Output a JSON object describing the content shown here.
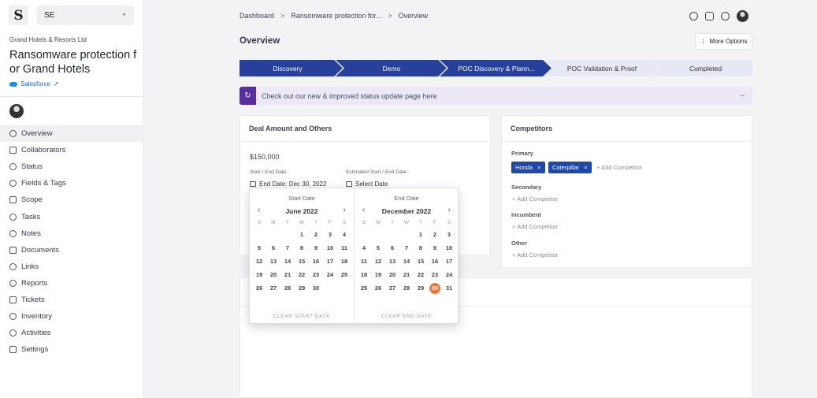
{
  "sidebar": {
    "logo_letter": "S",
    "workspace": "SE",
    "company": "Grand Hotels & Resorts Ltd",
    "title": "Ransomware protection f or Grand Hotels",
    "crm_link": "Salesforce",
    "nav": [
      {
        "label": "Overview",
        "icon": "overview-icon"
      },
      {
        "label": "Collaborators",
        "icon": "collaborators-icon"
      },
      {
        "label": "Status",
        "icon": "status-icon"
      },
      {
        "label": "Fields & Tags",
        "icon": "tag-icon"
      },
      {
        "label": "Scope",
        "icon": "scope-icon"
      },
      {
        "label": "Tasks",
        "icon": "tasks-icon"
      },
      {
        "label": "Notes",
        "icon": "notes-icon"
      },
      {
        "label": "Documents",
        "icon": "documents-icon"
      },
      {
        "label": "Links",
        "icon": "links-icon"
      },
      {
        "label": "Reports",
        "icon": "reports-icon"
      },
      {
        "label": "Tickets",
        "icon": "tickets-icon"
      },
      {
        "label": "Inventory",
        "icon": "inventory-icon"
      },
      {
        "label": "Activities",
        "icon": "activities-icon"
      },
      {
        "label": "Settings",
        "icon": "settings-icon"
      }
    ]
  },
  "breadcrumb": [
    "Dashboard",
    "Ransomware protection for...",
    "Overview"
  ],
  "page": {
    "title": "Overview",
    "more_options": "More Options"
  },
  "stages": [
    {
      "label": "Discovery",
      "done": true
    },
    {
      "label": "Demo",
      "done": true
    },
    {
      "label": "POC Discovery & Plann...",
      "done": true
    },
    {
      "label": "POC Validation & Proof",
      "done": false
    },
    {
      "label": "Completed",
      "done": false
    }
  ],
  "banner": {
    "text": "Check out our new & improved status update page here"
  },
  "deal": {
    "heading": "Deal Amount and Others",
    "amount": "$150,000",
    "start_end_label": "Start / End Date",
    "start_end_value": "End Date: Dec 30, 2022",
    "est_label": "Estimated Start / End Date",
    "est_value": "Select Date"
  },
  "competitors": {
    "heading": "Competitors",
    "primary_label": "Primary",
    "primary_chips": [
      "Honda",
      "Caterpillar"
    ],
    "secondary_label": "Secondary",
    "incumbent_label": "Incumbent",
    "other_label": "Other",
    "add_label": "Add Competitor"
  },
  "calendar": {
    "weekdays": [
      "S",
      "M",
      "T",
      "W",
      "T",
      "F",
      "S"
    ],
    "start": {
      "title": "Start Date",
      "month": "June 2022",
      "lead_blanks": 3,
      "days": 30,
      "selected": null,
      "clear": "CLEAR START DATE"
    },
    "end": {
      "title": "End Date",
      "month": "December 2022",
      "lead_blanks": 4,
      "days": 31,
      "selected": 30,
      "clear": "CLEAR END DATE"
    },
    "selected_color": "#e67a45"
  },
  "colors": {
    "stage_done": "#26409c",
    "stage_todo": "#e6e8f4",
    "chip": "#1f48a8",
    "banner": "#ece8f6"
  }
}
